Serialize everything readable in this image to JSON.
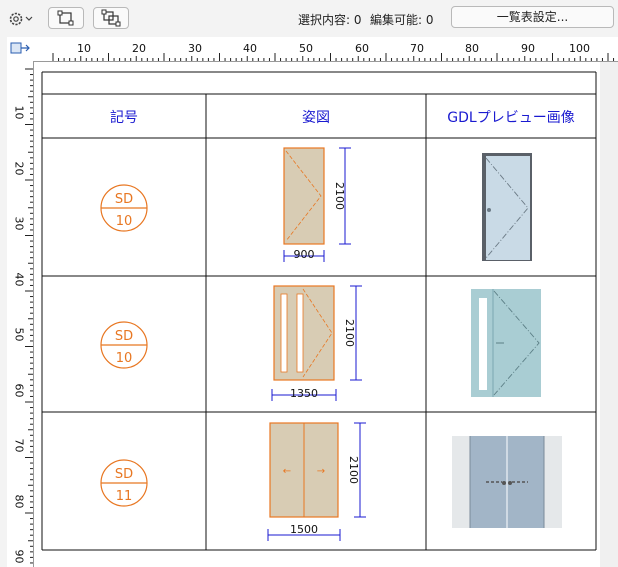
{
  "toolbar": {
    "status_selected": "選択内容: 0",
    "status_editable": "編集可能: 0",
    "list_settings_label": "一覧表設定...",
    "icons": [
      "gear-icon",
      "chevron-down-icon",
      "select-frame-icon",
      "group-select-icon"
    ]
  },
  "ruler": {
    "horizontal_labels": [
      "10",
      "20",
      "30",
      "40",
      "50",
      "60",
      "70",
      "80",
      "90",
      "100"
    ],
    "vertical_labels": [
      "10",
      "20",
      "30",
      "40",
      "50",
      "60",
      "70",
      "80",
      "90"
    ]
  },
  "schedule": {
    "headers": [
      "記号",
      "姿図",
      "GDLプレビュー画像"
    ],
    "rows": [
      {
        "symbol_code": "SD",
        "symbol_number": "10",
        "width": "900",
        "height": "2100"
      },
      {
        "symbol_code": "SD",
        "symbol_number": "10",
        "width": "1350",
        "height": "2100"
      },
      {
        "symbol_code": "SD",
        "symbol_number": "11",
        "width": "1500",
        "height": "2100"
      }
    ]
  },
  "colors": {
    "accent_orange": "#e87722",
    "dimension_blue": "#1a1ad0",
    "door_fill": "#d8ccb4"
  }
}
